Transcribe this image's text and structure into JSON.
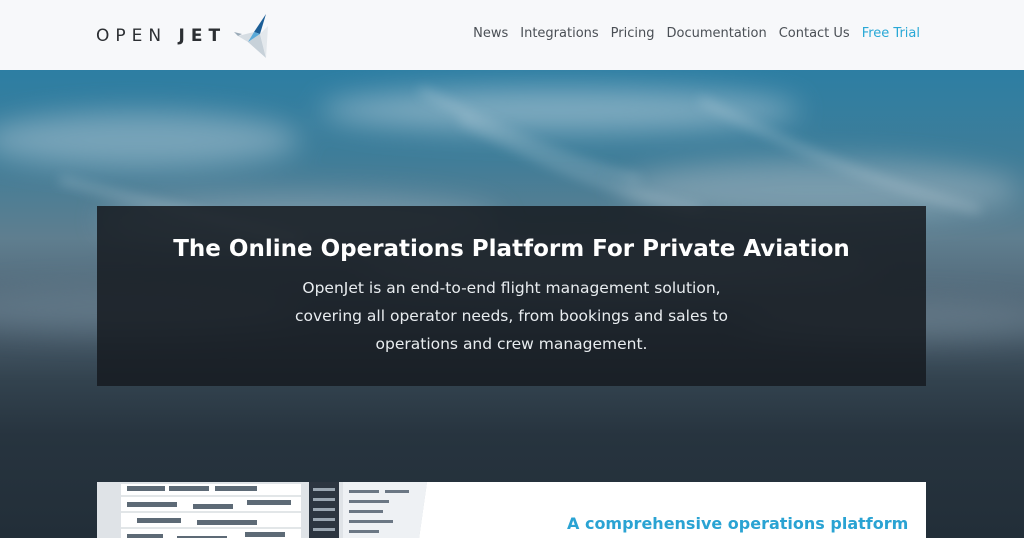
{
  "brand": {
    "name_light": "OPEN",
    "name_bold": "JET",
    "accent": "#29a8d6"
  },
  "nav": {
    "items": [
      {
        "label": "News"
      },
      {
        "label": "Integrations"
      },
      {
        "label": "Pricing"
      },
      {
        "label": "Documentation"
      },
      {
        "label": "Contact Us"
      },
      {
        "label": "Free Trial"
      }
    ]
  },
  "hero": {
    "title": "The Online Operations Platform For Private Aviation",
    "description": "OpenJet is an end-to-end flight management solution, covering all operator needs, from bookings and sales to operations and crew management."
  },
  "feature": {
    "title": "A comprehensive operations platform"
  },
  "icons": {
    "logo_mark": "origami-bird-icon"
  }
}
